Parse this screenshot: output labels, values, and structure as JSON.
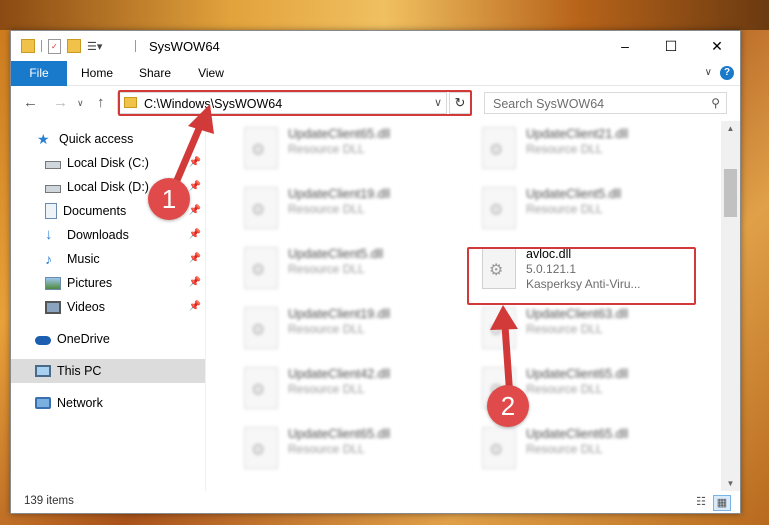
{
  "window": {
    "title": "SysWOW64",
    "minimize": "–",
    "maximize": "☐",
    "close": "✕"
  },
  "ribbon": {
    "tabs": [
      "File",
      "Home",
      "Share",
      "View"
    ],
    "help": "?"
  },
  "address": {
    "path": "C:\\Windows\\SysWOW64",
    "search_placeholder": "Search SysWOW64"
  },
  "nav": {
    "quick_access": "Quick access",
    "items": [
      {
        "label": "Local Disk (C:)"
      },
      {
        "label": "Local Disk (D:)"
      },
      {
        "label": "Documents"
      },
      {
        "label": "Downloads"
      },
      {
        "label": "Music"
      },
      {
        "label": "Pictures"
      },
      {
        "label": "Videos"
      }
    ],
    "onedrive": "OneDrive",
    "thispc": "This PC",
    "network": "Network"
  },
  "files": {
    "left": [
      {
        "name": "UpdateClient65.dll",
        "type": "Resource DLL"
      },
      {
        "name": "UpdateClient19.dll",
        "type": "Resource DLL"
      },
      {
        "name": "UpdateClient5.dll",
        "type": "Resource DLL"
      },
      {
        "name": "UpdateClient19.dll",
        "type": "Resource DLL"
      },
      {
        "name": "UpdateClient42.dll",
        "type": "Resource DLL"
      },
      {
        "name": "UpdateClient65.dll",
        "type": "Resource DLL"
      }
    ],
    "right": [
      {
        "name": "UpdateClient21.dll",
        "type": "Resource DLL"
      },
      {
        "name": "UpdateClient5.dll",
        "type": "Resource DLL"
      },
      {
        "name": "avloc.dll",
        "version": "5.0.121.1",
        "company": "Kasperksy Anti-Viru..."
      },
      {
        "name": "UpdateClient63.dll",
        "type": "Resource DLL"
      },
      {
        "name": "UpdateClient65.dll",
        "type": "Resource DLL"
      },
      {
        "name": "UpdateClient65.dll",
        "type": "Resource DLL"
      }
    ]
  },
  "status": {
    "count": "139 items"
  },
  "annotations": {
    "step1": "1",
    "step2": "2",
    "color": "#d23a3a"
  }
}
